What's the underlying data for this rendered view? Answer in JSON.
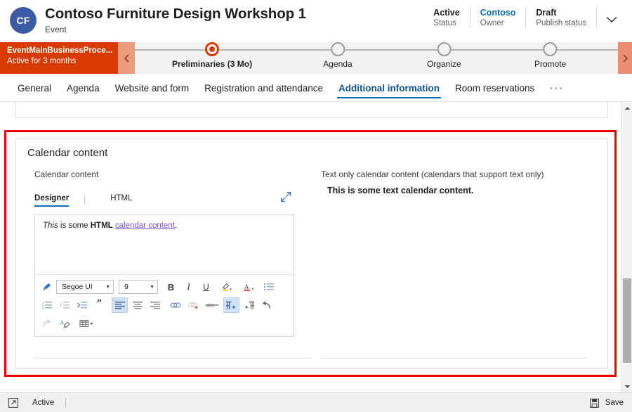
{
  "header": {
    "avatar_initials": "CF",
    "title": "Contoso Furniture Design Workshop 1",
    "subtitle": "Event",
    "stats": [
      {
        "value": "Active",
        "label": "Status",
        "link": false
      },
      {
        "value": "Contoso",
        "label": "Owner",
        "link": true
      },
      {
        "value": "Draft",
        "label": "Publish status",
        "link": false
      }
    ],
    "chevron_icon": "chevron-down-icon"
  },
  "process_flow": {
    "stage_name": "EventMainBusinessProce...",
    "stage_status": "Active for 3 months",
    "prev_icon": "chevron-left-icon",
    "next_icon": "chevron-right-icon",
    "stages": [
      {
        "label": "Preliminaries  (3 Mo)",
        "active": true
      },
      {
        "label": "Agenda",
        "active": false
      },
      {
        "label": "Organize",
        "active": false
      },
      {
        "label": "Promote",
        "active": false
      }
    ]
  },
  "tabs": {
    "items": [
      {
        "label": "General",
        "active": false
      },
      {
        "label": "Agenda",
        "active": false
      },
      {
        "label": "Website and form",
        "active": false
      },
      {
        "label": "Registration and attendance",
        "active": false
      },
      {
        "label": "Additional information",
        "active": true
      },
      {
        "label": "Room reservations",
        "active": false
      }
    ],
    "more_label": "···"
  },
  "calendar_section": {
    "section_title": "Calendar content",
    "left": {
      "field_label": "Calendar content",
      "switcher": {
        "designer_label": "Designer",
        "html_label": "HTML",
        "expand_icon": "expand-diagonal-icon"
      },
      "editor_text": {
        "italic_part": "This",
        "plain_part_1": " is some ",
        "bold_part": "HTML",
        "plain_part_2": " ",
        "link_part": "calendar content",
        "plain_part_3": "."
      },
      "toolbar": {
        "font_family": "Segoe UI",
        "font_size": "9",
        "row1": [
          {
            "name": "format-painter-icon",
            "glyph": "✐",
            "state": "normal"
          },
          {
            "name": "bold-button",
            "glyph": "B",
            "state": "normal"
          },
          {
            "name": "italic-button",
            "glyph": "I",
            "state": "normal"
          },
          {
            "name": "underline-button",
            "glyph": "U",
            "state": "normal"
          },
          {
            "name": "highlight-color-button",
            "glyph": "✎",
            "state": "normal"
          },
          {
            "name": "font-color-button",
            "glyph": "A",
            "state": "normal"
          },
          {
            "name": "bulleted-list-button",
            "glyph": "≡",
            "state": "normal"
          }
        ],
        "row2": [
          {
            "name": "numbered-list-button",
            "state": "normal"
          },
          {
            "name": "decrease-indent-button",
            "state": "disabled"
          },
          {
            "name": "increase-indent-button",
            "state": "normal"
          },
          {
            "name": "blockquote-button",
            "glyph": "”",
            "state": "normal"
          },
          {
            "name": "align-left-button",
            "state": "active"
          },
          {
            "name": "align-center-button",
            "state": "normal"
          },
          {
            "name": "align-right-button",
            "state": "normal"
          },
          {
            "name": "insert-link-button",
            "state": "normal"
          },
          {
            "name": "remove-link-button",
            "state": "disabled"
          },
          {
            "name": "strikethrough-button",
            "glyph": "abc",
            "state": "normal"
          },
          {
            "name": "ltr-direction-button",
            "state": "active"
          },
          {
            "name": "rtl-direction-button",
            "state": "normal"
          },
          {
            "name": "undo-button",
            "state": "normal"
          }
        ],
        "row3": [
          {
            "name": "redo-button",
            "state": "disabled"
          },
          {
            "name": "clear-formatting-button",
            "state": "normal"
          },
          {
            "name": "insert-table-button",
            "state": "normal"
          }
        ]
      }
    },
    "right": {
      "field_label": "Text only calendar content (calendars that support text only)",
      "field_value": "This is some text calendar content."
    }
  },
  "footer": {
    "expand_icon": "expand-popout-icon",
    "status": "Active",
    "save_icon": "save-disk-icon",
    "save_label": "Save"
  },
  "scrollbar": {
    "up_icon": "scroll-up-arrow-icon",
    "down_icon": "scroll-down-arrow-icon"
  },
  "colors": {
    "accent_blue": "#0f6cbd",
    "process_orange": "#d83b01",
    "highlight_red": "#ee0000",
    "link_purple": "#7551c9"
  }
}
